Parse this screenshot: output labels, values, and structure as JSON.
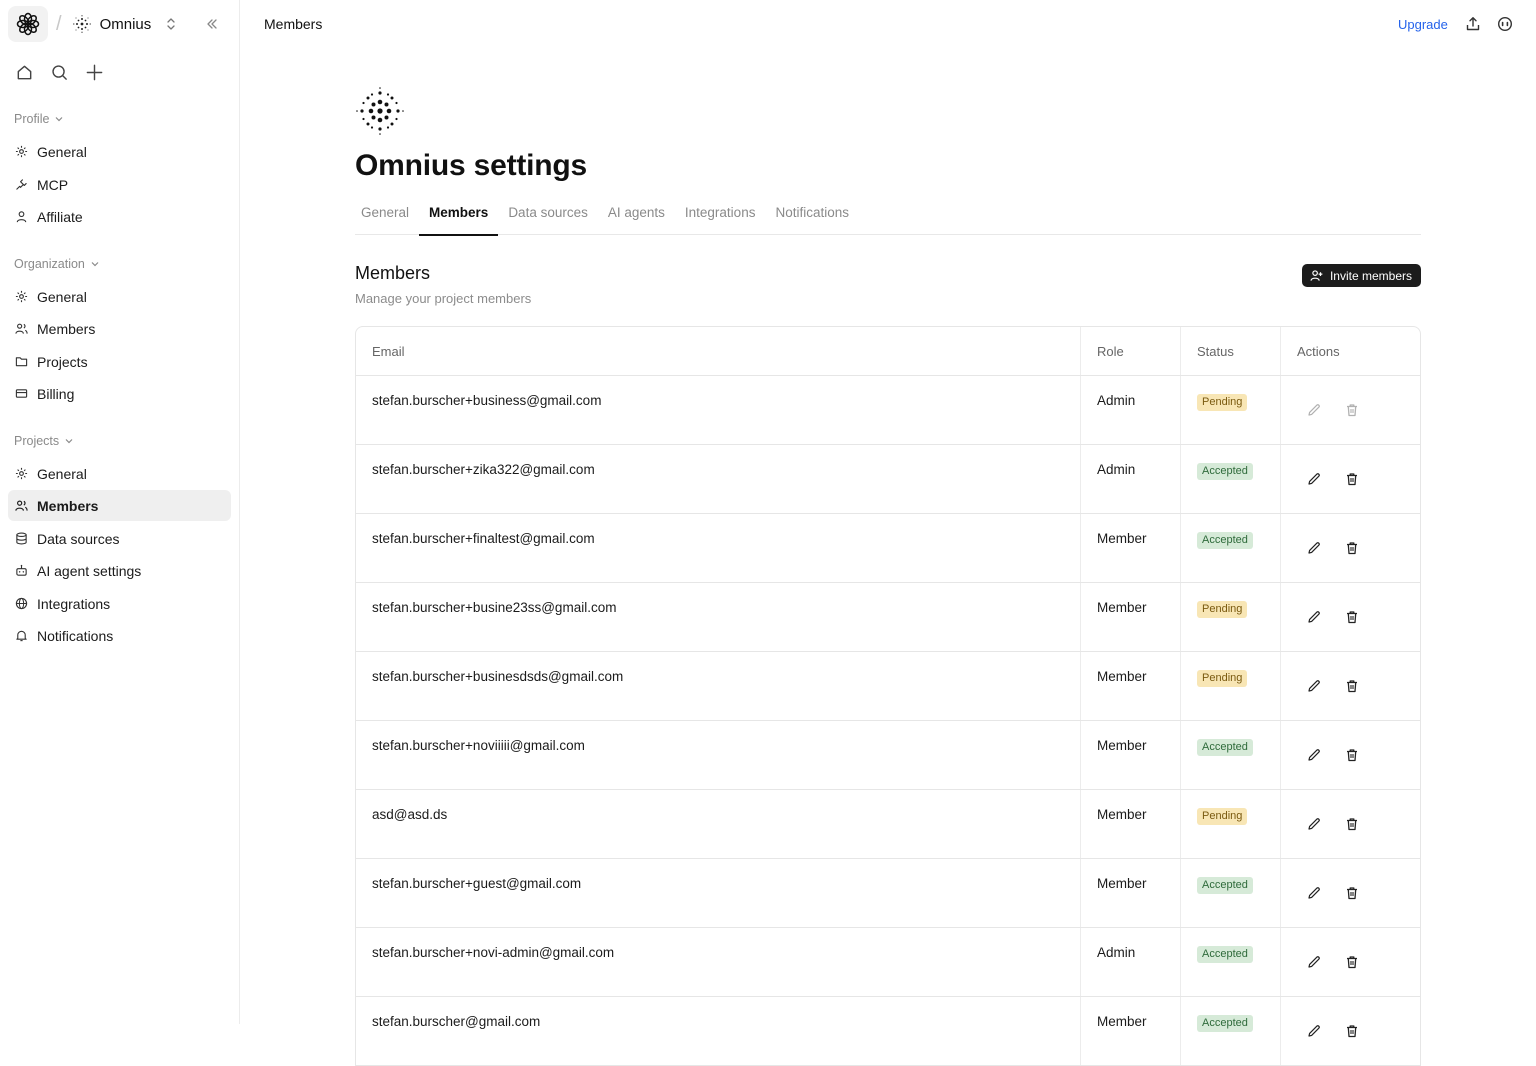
{
  "workspace": {
    "name": "Omnius"
  },
  "sidebar": {
    "sections": [
      {
        "label": "Profile",
        "items": [
          {
            "label": "General",
            "icon": "gear-icon"
          },
          {
            "label": "MCP",
            "icon": "plug-icon"
          },
          {
            "label": "Affiliate",
            "icon": "user-icon"
          }
        ]
      },
      {
        "label": "Organization",
        "items": [
          {
            "label": "General",
            "icon": "gear-icon"
          },
          {
            "label": "Members",
            "icon": "users-icon"
          },
          {
            "label": "Projects",
            "icon": "folder-icon"
          },
          {
            "label": "Billing",
            "icon": "credit-card-icon"
          }
        ]
      },
      {
        "label": "Projects",
        "items": [
          {
            "label": "General",
            "icon": "gear-icon"
          },
          {
            "label": "Members",
            "icon": "users-icon",
            "active": true
          },
          {
            "label": "Data sources",
            "icon": "database-icon"
          },
          {
            "label": "AI agent settings",
            "icon": "bot-icon"
          },
          {
            "label": "Integrations",
            "icon": "globe-icon"
          },
          {
            "label": "Notifications",
            "icon": "bell-icon"
          }
        ]
      }
    ]
  },
  "header": {
    "title": "Members",
    "upgrade_label": "Upgrade"
  },
  "page": {
    "title": "Omnius settings",
    "tabs": [
      {
        "label": "General"
      },
      {
        "label": "Members",
        "active": true
      },
      {
        "label": "Data sources"
      },
      {
        "label": "AI agents"
      },
      {
        "label": "Integrations"
      },
      {
        "label": "Notifications"
      }
    ]
  },
  "members": {
    "title": "Members",
    "subtitle": "Manage your project members",
    "invite_label": "Invite members",
    "columns": {
      "email": "Email",
      "role": "Role",
      "status": "Status",
      "actions": "Actions"
    },
    "rows": [
      {
        "email": "stefan.burscher+business@gmail.com",
        "role": "Admin",
        "status": "Pending",
        "actions_enabled": false
      },
      {
        "email": "stefan.burscher+zika322@gmail.com",
        "role": "Admin",
        "status": "Accepted",
        "actions_enabled": true
      },
      {
        "email": "stefan.burscher+finaltest@gmail.com",
        "role": "Member",
        "status": "Accepted",
        "actions_enabled": true
      },
      {
        "email": "stefan.burscher+busine23ss@gmail.com",
        "role": "Member",
        "status": "Pending",
        "actions_enabled": true
      },
      {
        "email": "stefan.burscher+businesdsds@gmail.com",
        "role": "Member",
        "status": "Pending",
        "actions_enabled": true
      },
      {
        "email": "stefan.burscher+noviiiii@gmail.com",
        "role": "Member",
        "status": "Accepted",
        "actions_enabled": true
      },
      {
        "email": "asd@asd.ds",
        "role": "Member",
        "status": "Pending",
        "actions_enabled": true
      },
      {
        "email": "stefan.burscher+guest@gmail.com",
        "role": "Member",
        "status": "Accepted",
        "actions_enabled": true
      },
      {
        "email": "stefan.burscher+novi-admin@gmail.com",
        "role": "Admin",
        "status": "Accepted",
        "actions_enabled": true
      },
      {
        "email": "stefan.burscher@gmail.com",
        "role": "Member",
        "status": "Accepted",
        "actions_enabled": true
      }
    ]
  },
  "colors": {
    "accent": "#2563eb",
    "pending_bg": "#f8e6b5",
    "accepted_bg": "#d6ead8",
    "primary_button": "#1c1c1c"
  }
}
